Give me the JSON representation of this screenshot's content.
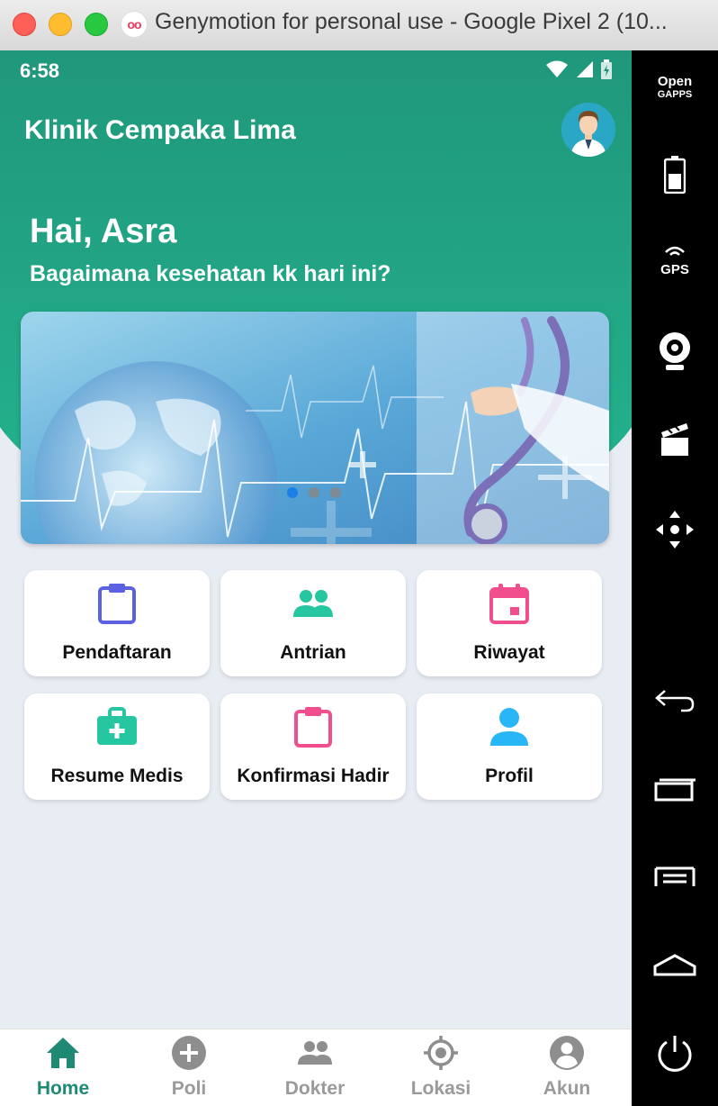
{
  "window": {
    "title": "Genymotion for personal use - Google Pixel 2 (10...",
    "logo_text": "oo"
  },
  "status_bar": {
    "time": "6:58"
  },
  "app": {
    "name": "Klinik Cempaka Lima",
    "greeting": "Hai, Asra",
    "subtitle": "Bagaimana kesehatan kk hari ini?"
  },
  "carousel": {
    "slide_count": 3,
    "active_index": 0
  },
  "menu": [
    {
      "label": "Pendaftaran",
      "icon": "clipboard-icon",
      "color": "#5b61e0"
    },
    {
      "label": "Antrian",
      "icon": "people-icon",
      "color": "#26c6a0"
    },
    {
      "label": "Riwayat",
      "icon": "calendar-icon",
      "color": "#f04e8c"
    },
    {
      "label": "Resume Medis",
      "icon": "medkit-icon",
      "color": "#26c6a0"
    },
    {
      "label": "Konfirmasi Hadir",
      "icon": "clipboard-icon",
      "color": "#f04e8c"
    },
    {
      "label": "Profil",
      "icon": "person-icon",
      "color": "#29b6f6"
    }
  ],
  "bottom_nav": [
    {
      "label": "Home",
      "icon": "home-icon",
      "active": true
    },
    {
      "label": "Poli",
      "icon": "plus-circle-icon",
      "active": false
    },
    {
      "label": "Dokter",
      "icon": "people-icon",
      "active": false
    },
    {
      "label": "Lokasi",
      "icon": "location-target-icon",
      "active": false
    },
    {
      "label": "Akun",
      "icon": "account-circle-icon",
      "active": false
    }
  ],
  "emulator_sidebar": {
    "open_gapps_line1": "Open",
    "open_gapps_line2": "GAPPS",
    "gps_label": "GPS"
  },
  "colors": {
    "primary": "#1e8a74",
    "header_top": "#1e8c74",
    "header_bottom": "#24b58f",
    "background": "#e8ecf3"
  }
}
